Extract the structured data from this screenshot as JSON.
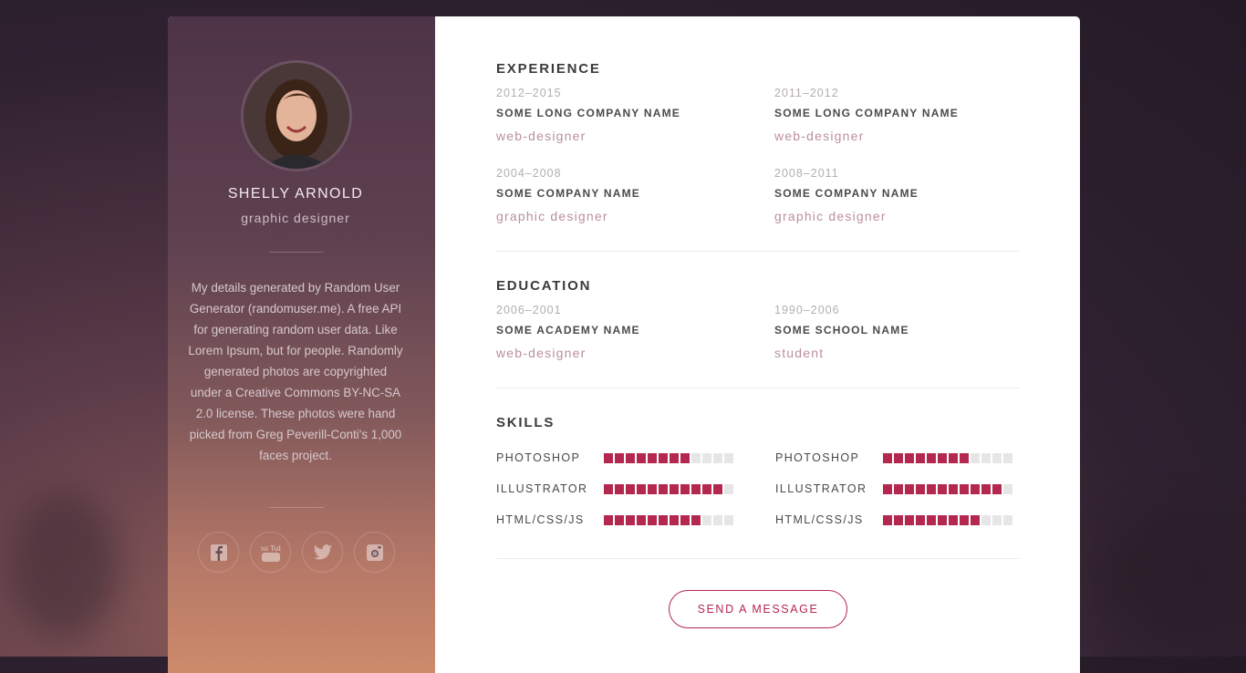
{
  "profile": {
    "name": "SHELLY ARNOLD",
    "title": "graphic designer",
    "bio": "My details generated by Random User Generator (randomuser.me). A free API for generating random user data. Like Lorem Ipsum, but for people. Randomly generated photos are copyrighted under a Creative Commons BY-NC-SA 2.0 license. These photos were hand picked from Greg Peverill-Conti's 1,000 faces project."
  },
  "social": [
    {
      "icon": "facebook-icon"
    },
    {
      "icon": "youtube-icon",
      "text": "You Tube"
    },
    {
      "icon": "twitter-icon"
    },
    {
      "icon": "instagram-icon"
    }
  ],
  "experience": {
    "title": "EXPERIENCE",
    "items": [
      {
        "date": "2012–2015",
        "company": "SOME LONG COMPANY NAME",
        "position": "web-designer"
      },
      {
        "date": "2011–2012",
        "company": "SOME LONG COMPANY NAME",
        "position": "web-designer"
      },
      {
        "date": "2004–2008",
        "company": "SOME COMPANY NAME",
        "position": "graphic designer"
      },
      {
        "date": "2008–2011",
        "company": "SOME COMPANY NAME",
        "position": "graphic designer"
      }
    ]
  },
  "education": {
    "title": "EDUCATION",
    "items": [
      {
        "date": "2006–2001",
        "company": "SOME ACADEMY NAME",
        "position": "web-designer"
      },
      {
        "date": "1990–2006",
        "company": "SOME SCHOOL NAME",
        "position": "student"
      }
    ]
  },
  "skills": {
    "title": "SKILLS",
    "total_segments": 12,
    "items": [
      {
        "label": "PHOTOSHOP",
        "level": 8
      },
      {
        "label": "PHOTOSHOP",
        "level": 8
      },
      {
        "label": "ILLUSTRATOR",
        "level": 11
      },
      {
        "label": "ILLUSTRATOR",
        "level": 11
      },
      {
        "label": "HTML/CSS/JS",
        "level": 9
      },
      {
        "label": "HTML/CSS/JS",
        "level": 9
      }
    ]
  },
  "cta": {
    "label": "SEND A MESSAGE"
  },
  "colors": {
    "accent": "#b4284f",
    "bar_empty": "#e6e6e6"
  }
}
